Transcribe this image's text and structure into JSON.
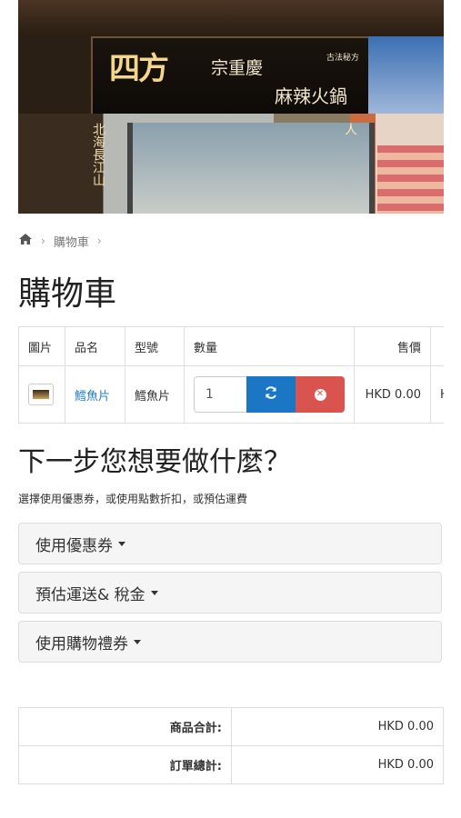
{
  "hero": {
    "sign_logo": "四方",
    "sign_sub1": "宗重慶",
    "sign_sub2": "麻辣火鍋",
    "sign_tag": "古法秘方",
    "vert_left": "北海長江山",
    "vert_right": "人"
  },
  "breadcrumb": {
    "home_icon": "home-icon",
    "current": "購物車"
  },
  "page_title": "購物車",
  "cart": {
    "headers": [
      "圖片",
      "品名",
      "型號",
      "數量",
      "售價"
    ],
    "rows": [
      {
        "name": "鱈魚片",
        "model": "鱈魚片",
        "quantity": "1",
        "price": "HKD 0.00",
        "overflow": "H"
      }
    ]
  },
  "next_step": {
    "title": "下一步您想要做什麼？",
    "hint": "選擇使用優惠券，或使用點數折扣，或預估運費",
    "panels": [
      "使用優惠券",
      "預估運送& 稅金",
      "使用購物禮券"
    ]
  },
  "totals": [
    {
      "label": "商品合計:",
      "value": "HKD 0.00"
    },
    {
      "label": "訂單總計:",
      "value": "HKD 0.00"
    }
  ],
  "colors": {
    "update": "#1b77c6",
    "remove": "#d9534f",
    "link": "#2a7fc7"
  }
}
